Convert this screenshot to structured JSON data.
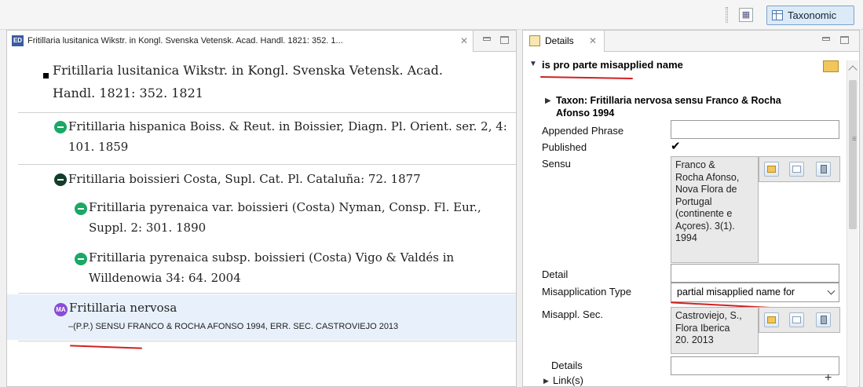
{
  "toolbar": {
    "perspective_label": "Taxonomic",
    "icons": [
      "open-perspective-icon",
      "grid-icon"
    ]
  },
  "left_panel": {
    "tab_title": "Fritillaria lusitanica Wikstr. in Kongl. Svenska Vetensk. Acad. Handl. 1821: 352. 1...",
    "tab_icon": "ED",
    "accepted": {
      "line1": "Fritillaria lusitanica Wikstr. in Kongl. Svenska Vetensk. Acad.",
      "line2": "Handl. 1821: 352. 1821"
    },
    "synonyms": [
      {
        "line1": "Fritillaria hispanica Boiss. & Reut. in Boissier, Diagn. Pl. Orient. ser. 2, 4:",
        "line2": "101. 1859"
      },
      {
        "line1": "Fritillaria boissieri Costa, Supl. Cat. Pl. Cataluña: 72. 1877"
      },
      {
        "line1": "Fritillaria pyrenaica var. boissieri (Costa) Nyman, Consp. Fl. Eur.,",
        "line2": "Suppl. 2: 301. 1890"
      },
      {
        "line1": "Fritillaria pyrenaica subsp. boissieri (Costa) Vigo & Valdés in",
        "line2": "Willdenowia 34: 64. 2004"
      }
    ],
    "misapplied": {
      "icon": "MA",
      "name": "Fritillaria nervosa",
      "sensu": "–(P.P.) SENSU FRANCO & ROCHA AFONSO 1994, ERR. SEC. CASTROVIEJO 2013"
    }
  },
  "details_panel": {
    "tab_title": "Details",
    "section_title": "is pro parte misapplied name",
    "taxon_line1": "Taxon: Fritillaria nervosa sensu Franco & Rocha",
    "taxon_line2": "Afonso 1994",
    "labels": {
      "appended_phrase": "Appended Phrase",
      "published": "Published",
      "sensu": "Sensu",
      "detail": "Detail",
      "misapplication_type": "Misapplication Type",
      "misappl_sec": "Misappl. Sec.",
      "details": "Details",
      "links": "Link(s)"
    },
    "appended_phrase_value": "",
    "published_checked": "✔",
    "sensu_reference": [
      "Franco &",
      "Rocha Afonso,",
      "Nova Flora de",
      "Portugal",
      "(continente e",
      "Açores). 3(1).",
      "1994"
    ],
    "detail_value": "",
    "misapplication_type_value": "partial misapplied name for",
    "misappl_sec_reference": [
      "Castroviejo, S.,",
      "Flora Iberica",
      "20. 2013"
    ],
    "details_value": "",
    "add_symbol": "+"
  }
}
